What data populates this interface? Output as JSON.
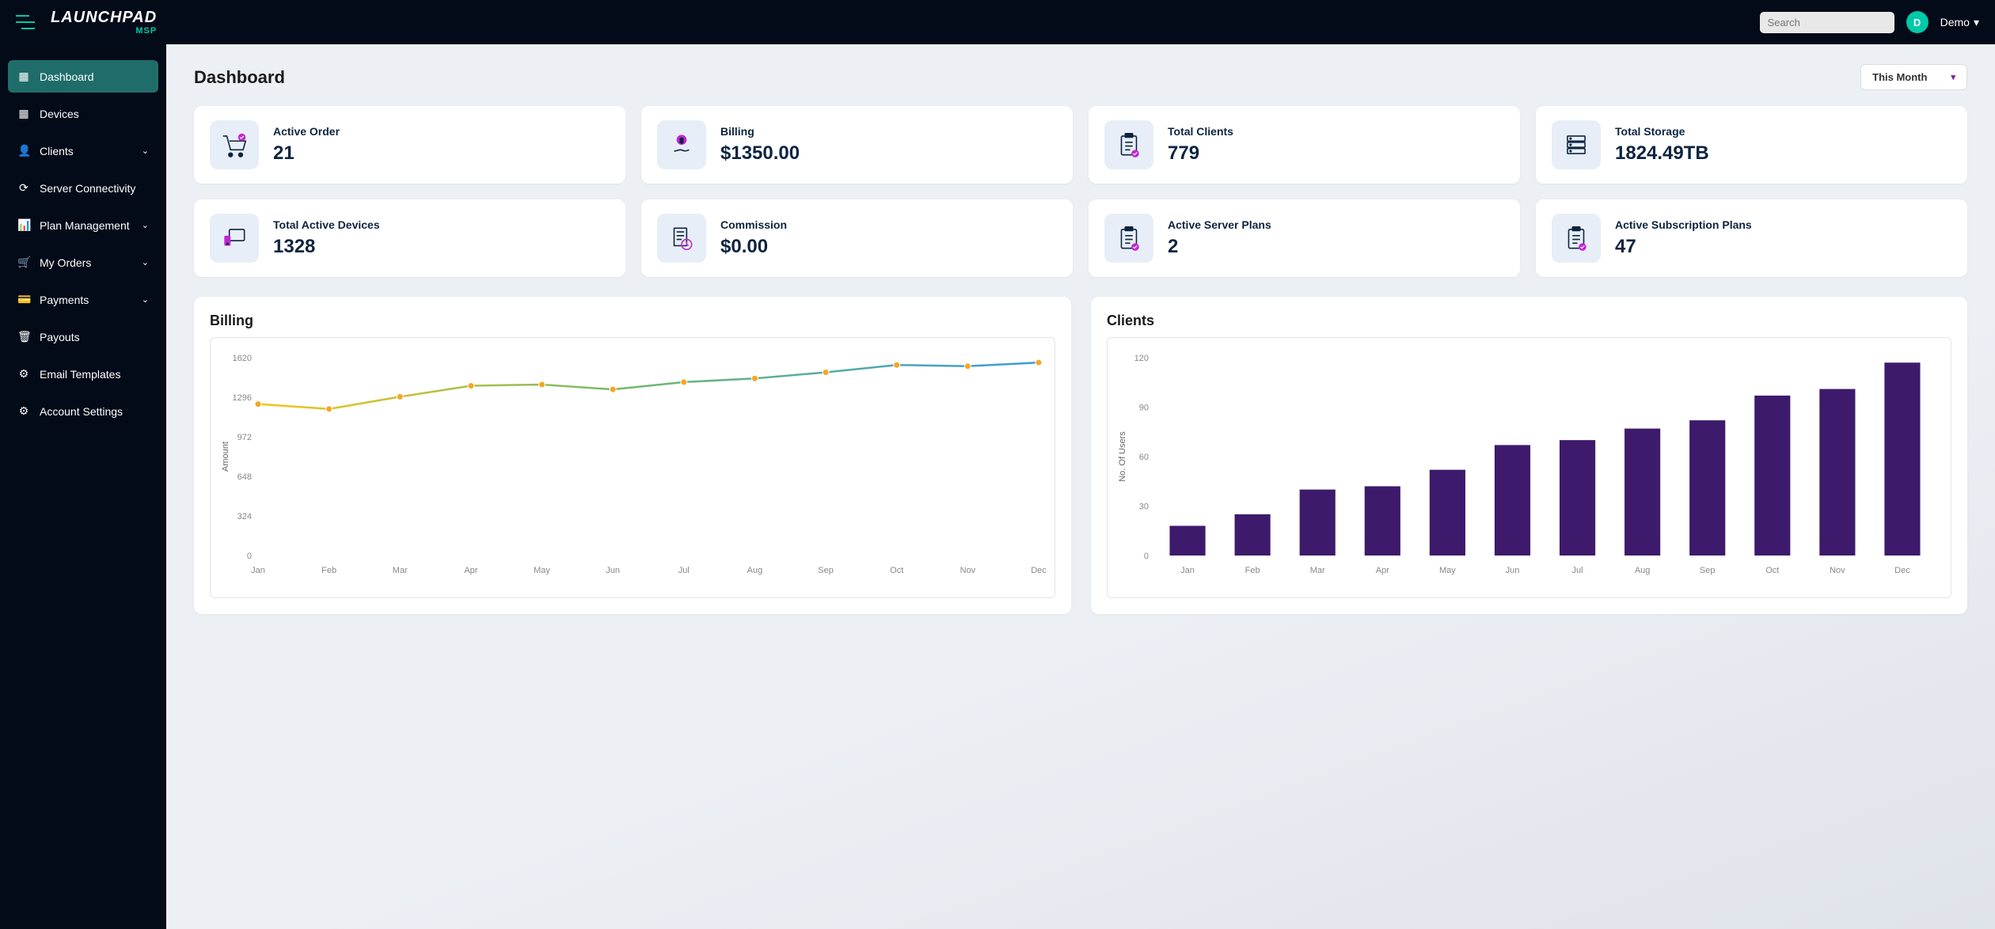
{
  "header": {
    "logo_main": "LAUNCHPAD",
    "logo_sub": "MSP",
    "search_placeholder": "Search",
    "avatar_letter": "D",
    "user_name": "Demo"
  },
  "sidebar": {
    "items": [
      {
        "label": "Dashboard",
        "icon": "▦",
        "active": true,
        "expandable": false
      },
      {
        "label": "Devices",
        "icon": "▦",
        "active": false,
        "expandable": false
      },
      {
        "label": "Clients",
        "icon": "👤",
        "active": false,
        "expandable": true
      },
      {
        "label": "Server Connectivity",
        "icon": "⟳",
        "active": false,
        "expandable": false
      },
      {
        "label": "Plan Management",
        "icon": "📊",
        "active": false,
        "expandable": true
      },
      {
        "label": "My Orders",
        "icon": "🛒",
        "active": false,
        "expandable": true
      },
      {
        "label": "Payments",
        "icon": "💳",
        "active": false,
        "expandable": true
      },
      {
        "label": "Payouts",
        "icon": "🗑",
        "active": false,
        "expandable": false
      },
      {
        "label": "Email Templates",
        "icon": "⚙",
        "active": false,
        "expandable": false
      },
      {
        "label": "Account Settings",
        "icon": "⚙",
        "active": false,
        "expandable": false
      }
    ]
  },
  "page": {
    "title": "Dashboard",
    "period_label": "This Month"
  },
  "stats": [
    {
      "label": "Active Order",
      "value": "21",
      "icon": "cart"
    },
    {
      "label": "Billing",
      "value": "$1350.00",
      "icon": "billing"
    },
    {
      "label": "Total Clients",
      "value": "779",
      "icon": "clipboard"
    },
    {
      "label": "Total Storage",
      "value": "1824.49TB",
      "icon": "storage"
    },
    {
      "label": "Total Active Devices",
      "value": "1328",
      "icon": "devices"
    },
    {
      "label": "Commission",
      "value": "$0.00",
      "icon": "receipt"
    },
    {
      "label": "Active Server Plans",
      "value": "2",
      "icon": "clipboard"
    },
    {
      "label": "Active Subscription Plans",
      "value": "47",
      "icon": "clipboard"
    }
  ],
  "chart_data": [
    {
      "type": "line",
      "title": "Billing",
      "xlabel": "",
      "ylabel": "Amount",
      "categories": [
        "Jan",
        "Feb",
        "Mar",
        "Apr",
        "May",
        "Jun",
        "Jul",
        "Aug",
        "Sep",
        "Oct",
        "Nov",
        "Dec"
      ],
      "values": [
        1240,
        1200,
        1300,
        1390,
        1400,
        1360,
        1420,
        1450,
        1500,
        1560,
        1550,
        1580
      ],
      "ylim": [
        0,
        1620
      ],
      "yticks": [
        0,
        324,
        648,
        972,
        1296,
        1620
      ]
    },
    {
      "type": "bar",
      "title": "Clients",
      "xlabel": "",
      "ylabel": "No. Of Users",
      "categories": [
        "Jan",
        "Feb",
        "Mar",
        "Apr",
        "May",
        "Jun",
        "Jul",
        "Aug",
        "Sep",
        "Oct",
        "Nov",
        "Dec"
      ],
      "values": [
        18,
        25,
        40,
        42,
        52,
        67,
        70,
        77,
        82,
        97,
        101,
        117
      ],
      "ylim": [
        0,
        120
      ],
      "yticks": [
        0,
        30,
        60,
        90,
        120
      ]
    }
  ]
}
